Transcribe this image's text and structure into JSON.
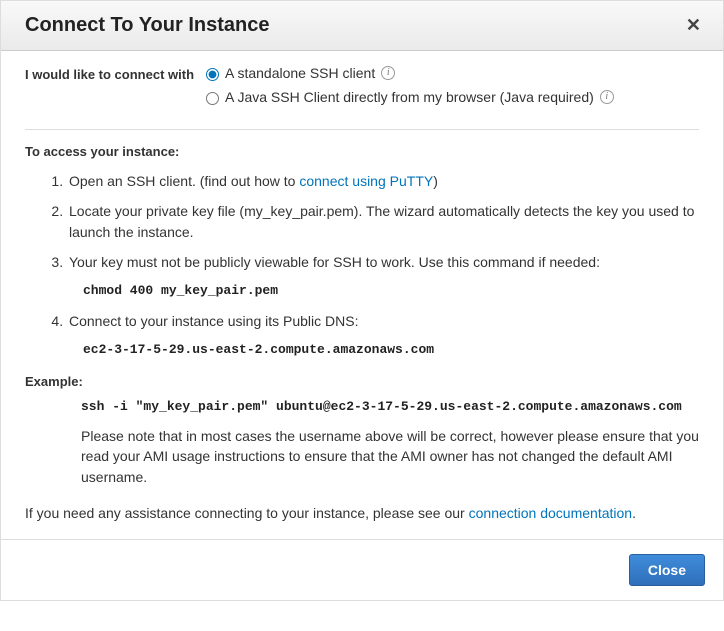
{
  "header": {
    "title": "Connect To Your Instance"
  },
  "connect": {
    "label": "I would like to connect with",
    "options": [
      {
        "label": "A standalone SSH client",
        "checked": true
      },
      {
        "label": "A Java SSH Client directly from my browser (Java required)",
        "checked": false
      }
    ]
  },
  "access_heading": "To access your instance:",
  "steps": {
    "s1_a": "Open an SSH client. (find out how to ",
    "s1_link": "connect using PuTTY",
    "s1_b": ")",
    "s2": "Locate your private key file (my_key_pair.pem). The wizard automatically detects the key you used to launch the instance.",
    "s3": "Your key must not be publicly viewable for SSH to work. Use this command if needed:",
    "s3_code": "chmod 400 my_key_pair.pem",
    "s4": "Connect to your instance using its Public DNS:",
    "s4_code": "ec2-3-17-5-29.us-east-2.compute.amazonaws.com"
  },
  "example": {
    "heading": "Example:",
    "code": "ssh -i \"my_key_pair.pem\" ubuntu@ec2-3-17-5-29.us-east-2.compute.amazonaws.com",
    "note": "Please note that in most cases the username above will be correct, however please ensure that you read your AMI usage instructions to ensure that the AMI owner has not changed the default AMI username."
  },
  "footer": {
    "text_a": "If you need any assistance connecting to your instance, please see our ",
    "link": "connection documentation",
    "text_b": "."
  },
  "buttons": {
    "close": "Close"
  }
}
